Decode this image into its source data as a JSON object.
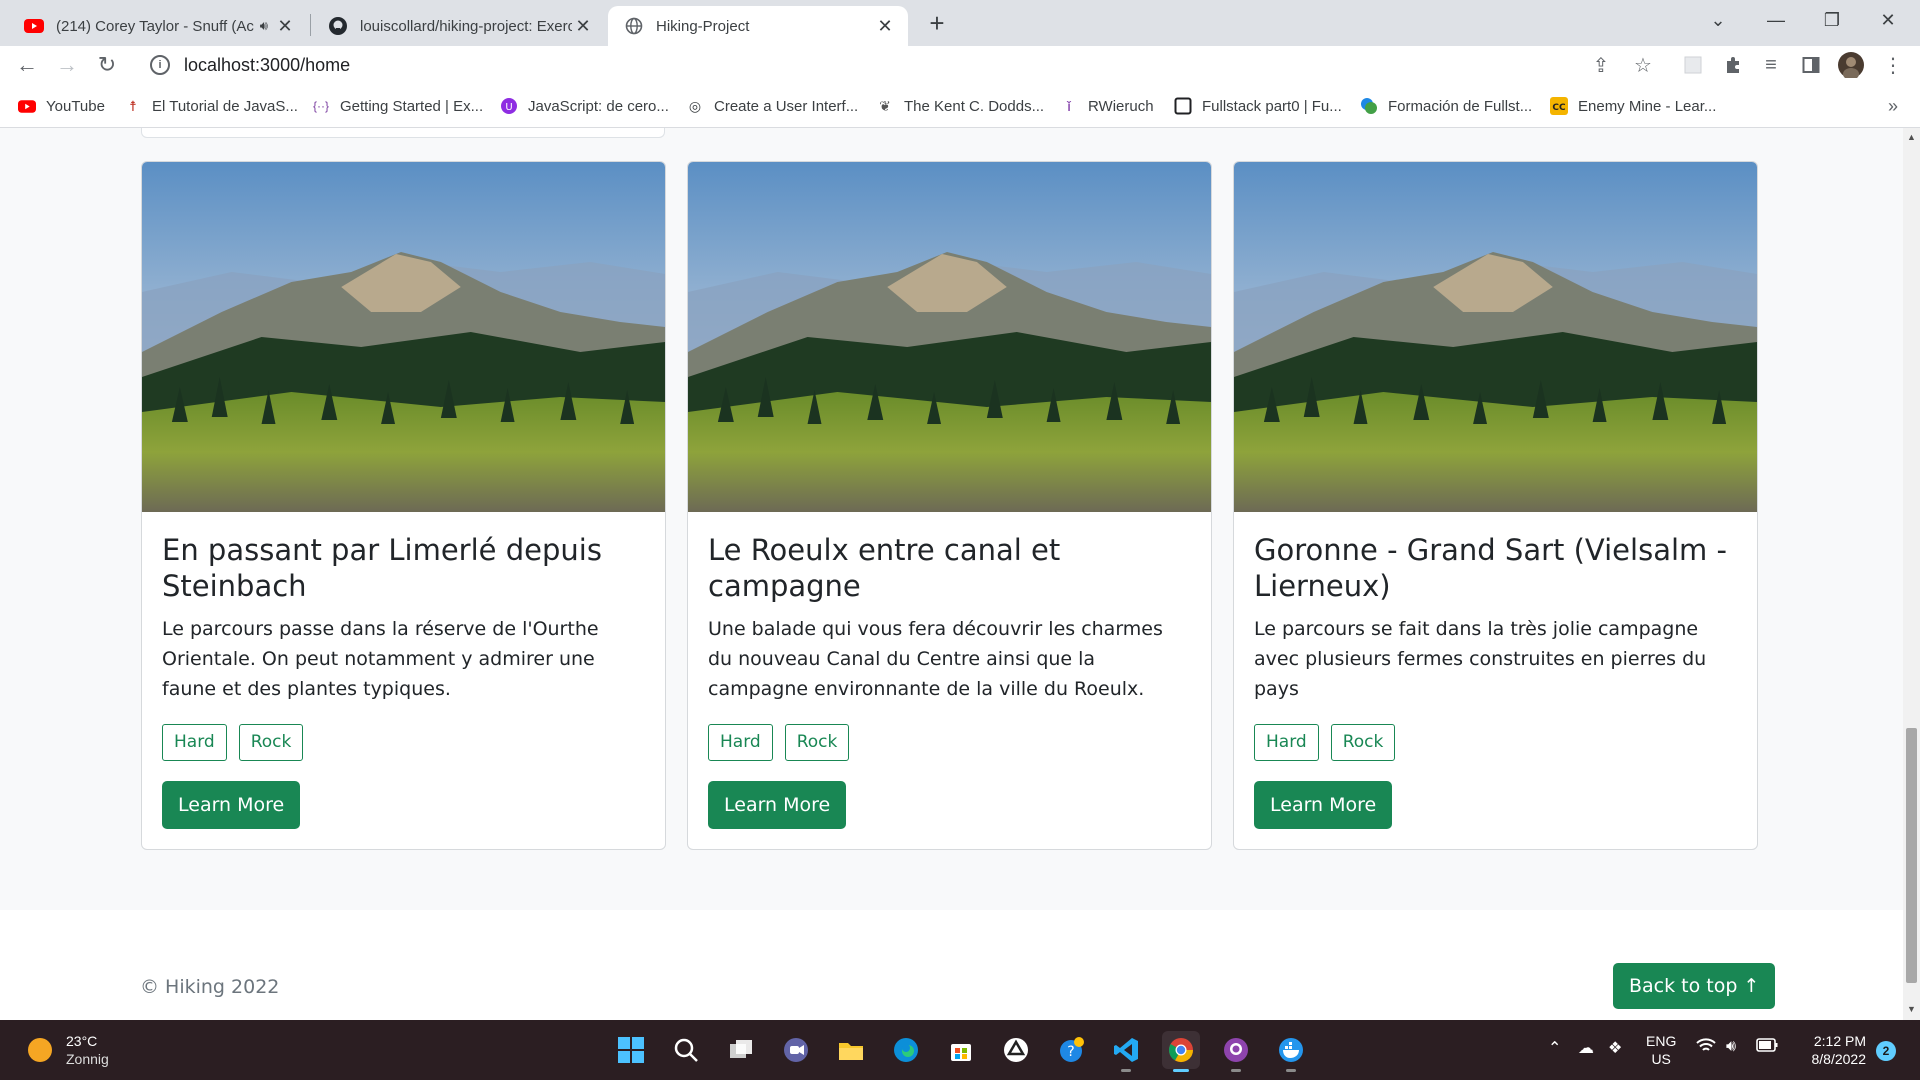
{
  "browser": {
    "tabs": [
      {
        "title": "(214) Corey Taylor - Snuff (Ac",
        "icon": "youtube-icon"
      },
      {
        "title": "louiscollard/hiking-project: Exerc",
        "icon": "github-icon"
      },
      {
        "title": "Hiking-Project",
        "icon": "globe-icon"
      }
    ],
    "url": "localhost:3000/home",
    "bookmarks": [
      {
        "label": "YouTube",
        "icon": "youtube-icon"
      },
      {
        "label": "El Tutorial de JavaS...",
        "icon": "person-icon"
      },
      {
        "label": "Getting Started | Ex...",
        "icon": "code-icon"
      },
      {
        "label": "JavaScript: de cero...",
        "icon": "circle-icon"
      },
      {
        "label": "Create a User Interf...",
        "icon": "glasses-icon"
      },
      {
        "label": "The Kent C. Dodds...",
        "icon": "koala-icon"
      },
      {
        "label": "RWieruch",
        "icon": "figure-icon"
      },
      {
        "label": "Fullstack part0 | Fu...",
        "icon": "square-icon"
      },
      {
        "label": "Formación de Fullst...",
        "icon": "blob-icon"
      },
      {
        "label": "Enemy Mine - Lear...",
        "icon": "cc-icon"
      }
    ]
  },
  "cards": [
    {
      "title": "En passant par Limerlé depuis Steinbach",
      "text": "Le parcours passe dans la réserve de l'Ourthe Orientale. On peut notamment y admirer une faune et des plantes typiques.",
      "tags": [
        "Hard",
        "Rock"
      ],
      "button": "Learn More"
    },
    {
      "title": "Le Roeulx entre canal et campagne",
      "text": "Une balade qui vous fera découvrir les charmes du nouveau Canal du Centre ainsi que la campagne environnante de la ville du Roeulx.",
      "tags": [
        "Hard",
        "Rock"
      ],
      "button": "Learn More"
    },
    {
      "title": "Goronne - Grand Sart (Vielsalm - Lierneux)",
      "text": "Le parcours se fait dans la très jolie campagne avec plusieurs fermes construites en pierres du pays",
      "tags": [
        "Hard",
        "Rock"
      ],
      "button": "Learn More"
    }
  ],
  "footer": {
    "copyright": "© Hiking 2022",
    "back_to_top": "Back to top ↑"
  },
  "taskbar": {
    "weather_temp": "23°C",
    "weather_desc": "Zonnig",
    "lang_1": "ENG",
    "lang_2": "US",
    "time": "2:12 PM",
    "date": "8/8/2022",
    "notifications": "2"
  },
  "colors": {
    "accent": "#198754",
    "taskbar": "#2b1e22",
    "chrome_frame": "#dee1e6"
  }
}
